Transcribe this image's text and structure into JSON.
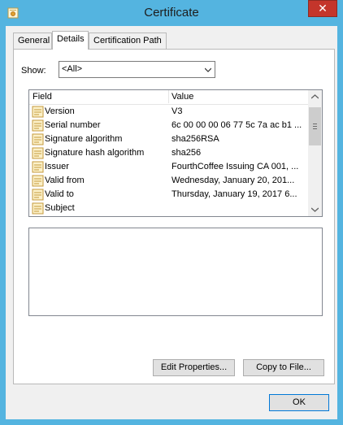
{
  "window": {
    "title": "Certificate",
    "close_glyph": "✕"
  },
  "tabs": [
    "General",
    "Details",
    "Certification Path"
  ],
  "show": {
    "label": "Show:",
    "value": "<All>"
  },
  "fields_table": {
    "headers": [
      "Field",
      "Value"
    ],
    "rows": [
      {
        "field": "Version",
        "value": "V3"
      },
      {
        "field": "Serial number",
        "value": "6c 00 00 00 06 77 5c 7a ac b1 ..."
      },
      {
        "field": "Signature algorithm",
        "value": "sha256RSA"
      },
      {
        "field": "Signature hash algorithm",
        "value": "sha256"
      },
      {
        "field": "Issuer",
        "value": "FourthCoffee Issuing CA 001, ..."
      },
      {
        "field": "Valid from",
        "value": "Wednesday, January 20, 201..."
      },
      {
        "field": "Valid to",
        "value": "Thursday, January 19, 2017 6..."
      },
      {
        "field": "Subject",
        "value": ""
      }
    ]
  },
  "buttons": {
    "edit_properties": "Edit Properties...",
    "copy_to_file": "Copy to File...",
    "ok": "OK"
  }
}
